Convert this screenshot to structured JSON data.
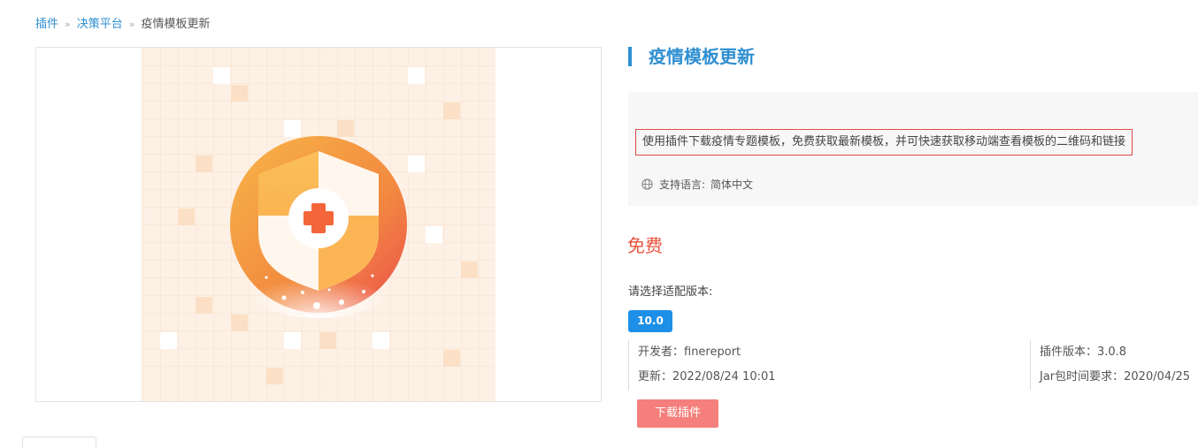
{
  "breadcrumb": {
    "items": [
      "插件",
      "决策平台"
    ],
    "separator": "»",
    "current": "疫情模板更新"
  },
  "hero_image": {
    "icon": "shield-medical-cross-icon",
    "colors": {
      "background": "#fdf1e6",
      "circle": "#f39a3e",
      "shield": "#fbb555",
      "cross": "#f4663a"
    }
  },
  "plugin": {
    "title": "疫情模板更新",
    "description": "使用插件下载疫情专题模板，免费获取最新模板，并可快速获取移动端查看模板的二维码和链接",
    "language_label": "支持语言:",
    "language_value": "简体中文",
    "language_icon": "globe-icon",
    "price": "免费",
    "version_prompt": "请选择适配版本:",
    "version_option": "10.0",
    "developer": "开发者：finereport",
    "updated": "更新：2022/08/24 10:01",
    "plugin_version": "插件版本：3.0.8",
    "jar_requirement": "Jar包时间要求：2020/04/25",
    "download_label": "下载插件"
  },
  "colors": {
    "accent_blue": "#2f8fd1",
    "price_red": "#e8543c",
    "chip_blue": "#1d8fe6",
    "download_btn": "#f47f7c",
    "highlight_border": "#e04a4a"
  }
}
